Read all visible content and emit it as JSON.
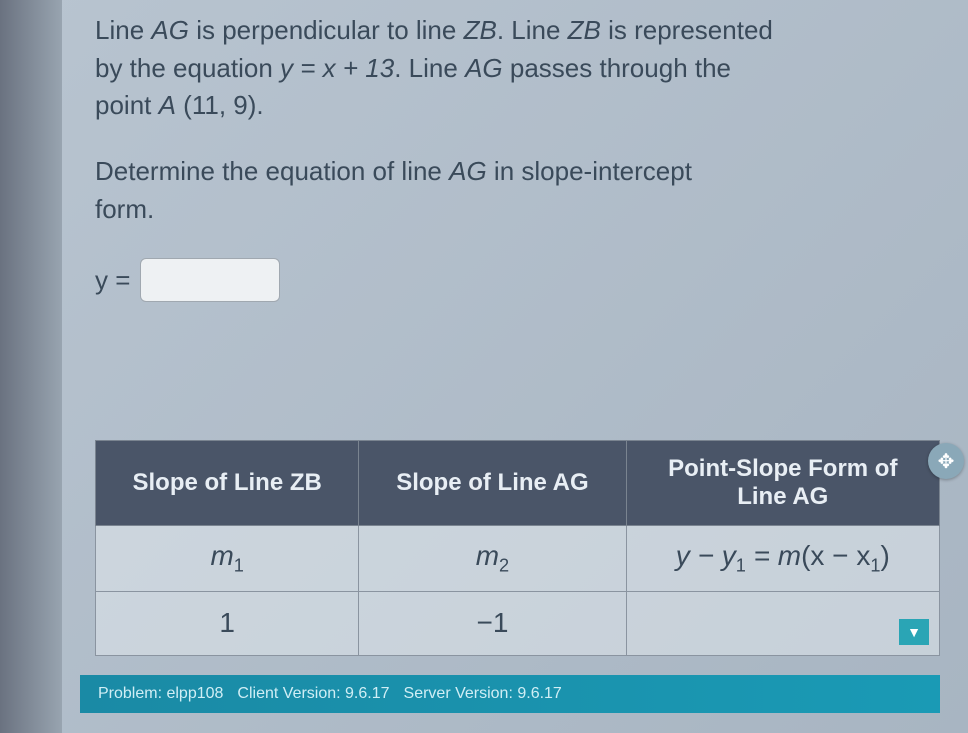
{
  "problem": {
    "line1_a": "Line ",
    "line1_ag": "AG",
    "line1_b": " is perpendicular to line ",
    "line1_zb": "ZB",
    "line1_c": ". Line ",
    "line1_zb2": "ZB",
    "line1_d": " is represented",
    "line2_a": "by the equation ",
    "line2_eq": "y = x + 13",
    "line2_b": ". Line ",
    "line2_ag": "AG",
    "line2_c": " passes through the",
    "line3_a": "point ",
    "line3_pt": "A",
    "line3_coords": " (11, 9)."
  },
  "instruction": {
    "a": "Determine the equation of line ",
    "ag": "AG",
    "b": " in slope-intercept",
    "c": "form."
  },
  "answer": {
    "label": "y =",
    "value": ""
  },
  "table": {
    "headers": {
      "col1": "Slope of Line ZB",
      "col2": "Slope of Line AG",
      "col3_top": "Point-Slope Form of",
      "col3_bot": "Line AG"
    },
    "row1": {
      "c1_var": "m",
      "c1_sub": "1",
      "c2_var": "m",
      "c2_sub": "2",
      "c3_a": "y − y",
      "c3_s1": "1",
      "c3_b": " = m",
      "c3_c": "(x − x",
      "c3_s2": "1",
      "c3_d": ")"
    },
    "row2": {
      "c1": "1",
      "c2": "−1",
      "c3": ""
    }
  },
  "footer": {
    "problem": "Problem: elpp108",
    "client": "Client Version: 9.6.17",
    "server": "Server Version: 9.6.17"
  }
}
